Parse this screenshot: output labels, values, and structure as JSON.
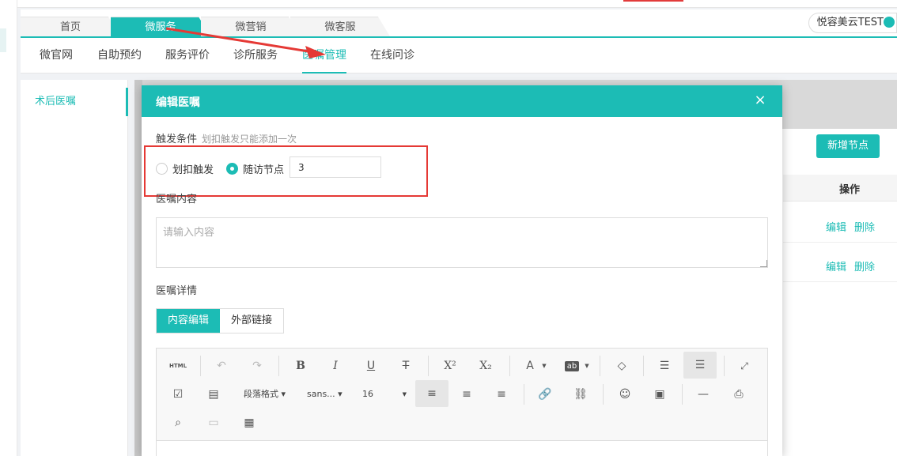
{
  "top_tabs": [
    {
      "label": "首页",
      "active": false
    },
    {
      "label": "微服务",
      "active": true
    },
    {
      "label": "微营销",
      "active": false
    },
    {
      "label": "微客服",
      "active": false
    }
  ],
  "user": {
    "name": "悦容美云TEST"
  },
  "subnav": [
    {
      "label": "微官网",
      "active": false
    },
    {
      "label": "自助预约",
      "active": false
    },
    {
      "label": "服务评价",
      "active": false
    },
    {
      "label": "诊所服务",
      "active": false
    },
    {
      "label": "医嘱管理",
      "active": true
    },
    {
      "label": "在线问诊",
      "active": false
    }
  ],
  "sidebar": {
    "items": [
      {
        "label": "术后医嘱"
      }
    ]
  },
  "content": {
    "add_node_label": "新增节点",
    "column_action": "操作",
    "rows": [
      {
        "edit": "编辑",
        "delete": "删除"
      },
      {
        "edit": "编辑",
        "delete": "删除"
      }
    ]
  },
  "dialog": {
    "title": "编辑医嘱",
    "close_icon": "×",
    "trigger_label": "触发条件",
    "trigger_hint": "划扣触发只能添加一次",
    "radio_deduct": "划扣触发",
    "radio_followup": "随访节点",
    "followup_value": "3",
    "content_label": "医嘱内容",
    "content_placeholder": "请输入内容",
    "detail_label": "医嘱详情",
    "tab_edit": "内容编辑",
    "tab_link": "外部链接",
    "editor": {
      "html_label": "HTML",
      "paragraph_format": "段落格式",
      "font_family": "sans...",
      "font_size": "16"
    }
  },
  "colors": {
    "accent": "#1cbcb5",
    "highlight": "#e53935"
  }
}
